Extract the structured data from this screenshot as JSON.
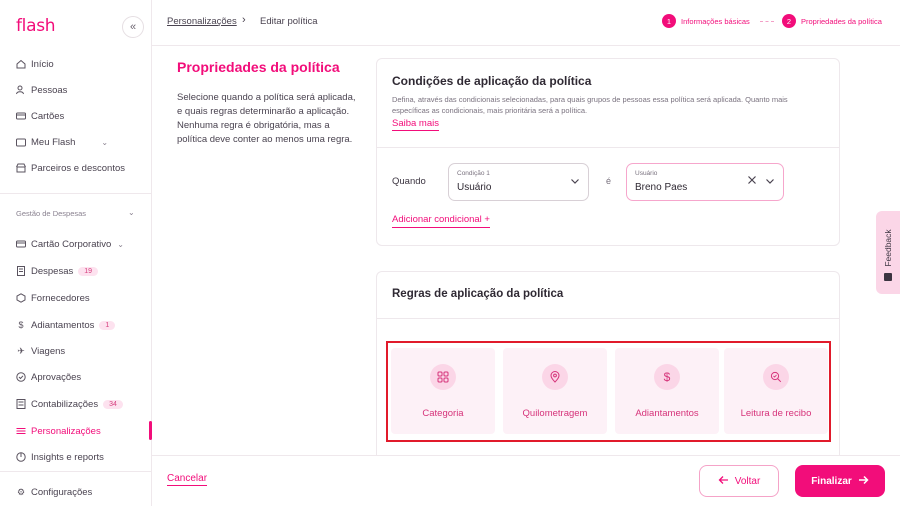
{
  "sidebar": {
    "logo": "flash",
    "collapse_icon": "«",
    "items": [
      {
        "label": "Início",
        "icon": "home-icon"
      },
      {
        "label": "Pessoas",
        "icon": "people-icon"
      },
      {
        "label": "Cartões",
        "icon": "card-icon"
      },
      {
        "label": "Meu Flash",
        "icon": "wallet-icon"
      },
      {
        "label": "Parceiros e descontos",
        "icon": "store-icon"
      }
    ],
    "section_label": "Gestão de Despesas",
    "expense_items": [
      {
        "label": "Cartão Corporativo",
        "icon": "card-icon"
      },
      {
        "label": "Despesas",
        "badge": "19",
        "icon": "receipt-icon"
      },
      {
        "label": "Fornecedores",
        "icon": "box-icon"
      },
      {
        "label": "Adiantamentos",
        "badge": "1",
        "icon": "dollar-icon"
      },
      {
        "label": "Viagens",
        "icon": "plane-icon"
      },
      {
        "label": "Aprovações",
        "icon": "check-circle-icon"
      },
      {
        "label": "Contabilizações",
        "badge": "34",
        "icon": "ledger-icon"
      },
      {
        "label": "Personalizações",
        "icon": "sliders-icon"
      },
      {
        "label": "Insights e reports",
        "icon": "chart-icon"
      }
    ],
    "settings_label": "Configurações"
  },
  "topbar": {
    "crumb_parent": "Personalizações",
    "crumb_current": "Editar política",
    "steps": [
      {
        "num": "1",
        "label": "Informações básicas"
      },
      {
        "num": "2",
        "label": "Propriedades da política"
      }
    ]
  },
  "panel": {
    "title": "Propriedades da política",
    "description": "Selecione quando a política será aplicada, e quais regras determinarão a aplicação. Nenhuma regra é obrigatória, mas a política deve conter ao menos uma regra."
  },
  "conditions": {
    "title": "Condições de aplicação da política",
    "description": "Defina, através das condicionais selecionadas, para quais grupos de pessoas essa política será aplicada. Quanto mais específicas as condicionais, mais prioritária será a política.",
    "link": "Saiba mais",
    "when_label": "Quando",
    "condition_field_label": "Condição 1",
    "condition_value": "Usuário",
    "is_label": "é",
    "user_field_label": "Usuário",
    "user_value": "Breno Paes",
    "add_condition": "Adicionar condicional +"
  },
  "rules": {
    "title": "Regras de aplicação da política",
    "items": [
      {
        "label": "Categoria",
        "icon": "grid-icon"
      },
      {
        "label": "Quilometragem",
        "icon": "map-pin-icon"
      },
      {
        "label": "Adiantamentos",
        "icon": "dollar-icon"
      },
      {
        "label": "Leitura de recibo",
        "icon": "search-icon"
      }
    ]
  },
  "footer": {
    "cancel": "Cancelar",
    "back": "Voltar",
    "finish": "Finalizar"
  },
  "feedback": "Feedback",
  "colors": {
    "accent": "#f20d7a",
    "highlight": "#e11a2b"
  }
}
